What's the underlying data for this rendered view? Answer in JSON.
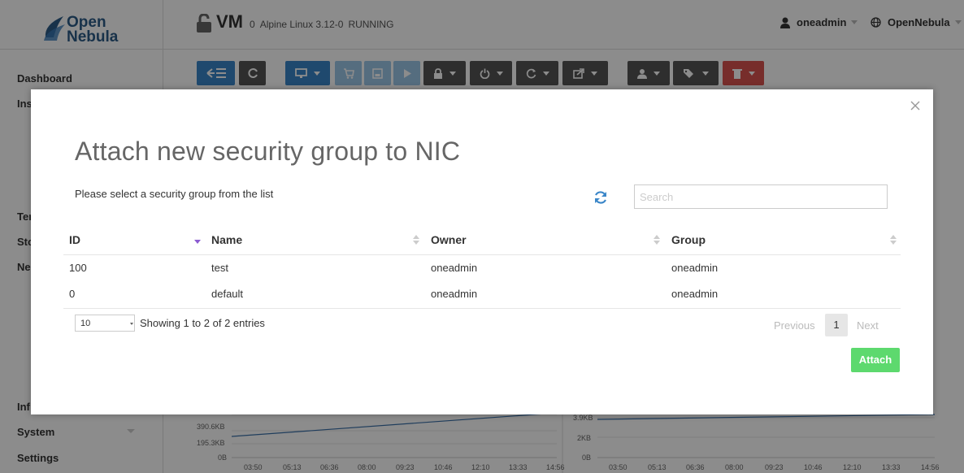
{
  "header": {
    "logo_line1": "Open",
    "logo_line2": "Nebula",
    "vm_label": "VM",
    "vm_id": "0",
    "vm_os": "Alpine Linux 3.12-0",
    "vm_state": "RUNNING",
    "user": "oneadmin",
    "zone": "OpenNebula"
  },
  "sidebar": {
    "items": [
      "Dashboard",
      "Ins",
      "Ter",
      "Sto",
      "Ne",
      "Inf",
      "System",
      "Settings"
    ]
  },
  "charts": {
    "left_y_ticks": [
      "390.6KB",
      "195.3KB",
      "0B"
    ],
    "right_y_ticks": [
      "3.9KB",
      "2KB",
      "0B"
    ],
    "x_ticks": [
      "03:50",
      "05:13",
      "06:36",
      "08:00",
      "09:23",
      "10:46",
      "12:10",
      "13:33",
      "14:56"
    ]
  },
  "modal": {
    "title": "Attach new security group to NIC",
    "instruction": "Please select a security group from the list",
    "search_placeholder": "Search",
    "columns": [
      "ID",
      "Name",
      "Owner",
      "Group"
    ],
    "rows": [
      {
        "id": "100",
        "name": "test",
        "owner": "oneadmin",
        "group": "oneadmin"
      },
      {
        "id": "0",
        "name": "default",
        "owner": "oneadmin",
        "group": "oneadmin"
      }
    ],
    "page_size": "10",
    "info": "Showing 1 to 2 of 2 entries",
    "prev": "Previous",
    "current_page": "1",
    "next": "Next",
    "attach_label": "Attach"
  },
  "colors": {
    "primary": "#3a86c8",
    "attach": "#5dd96e",
    "danger": "#d9534f",
    "sort_active": "#8b5bd1"
  }
}
